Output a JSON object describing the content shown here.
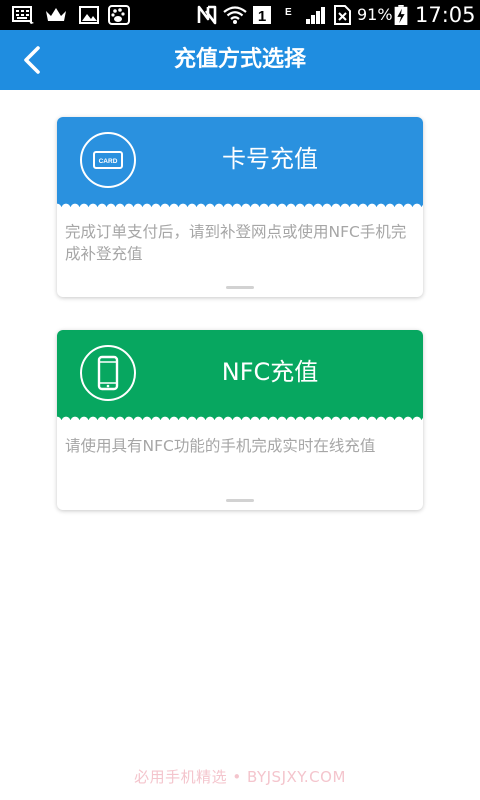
{
  "status_bar": {
    "battery_percent": "91%",
    "time": "17:05",
    "icons": [
      "keyboard-icon",
      "crown-icon",
      "image-icon",
      "baidu-paw-icon",
      "nfc-n-icon",
      "wifi-icon",
      "sim-1-icon",
      "e-network-icon",
      "signal-icon",
      "no-sim-icon",
      "battery-charging-icon"
    ]
  },
  "header": {
    "title": "充值方式选择",
    "back_icon": "back-chevron-icon"
  },
  "options": [
    {
      "title": "卡号充值",
      "description": "完成订单支付后，请到补登网点或使用NFC手机完成补登充值",
      "icon": "card-icon",
      "color": "#2a91df"
    },
    {
      "title": "NFC充值",
      "description": "请使用具有NFC功能的手机完成实时在线充值",
      "icon": "phone-icon",
      "color": "#07a760"
    }
  ],
  "watermark": "必用手机精选 • BYJSJXY.COM",
  "colors": {
    "header": "#1f8de0",
    "status_bar": "#000000",
    "description_text": "#a6a6a6"
  }
}
